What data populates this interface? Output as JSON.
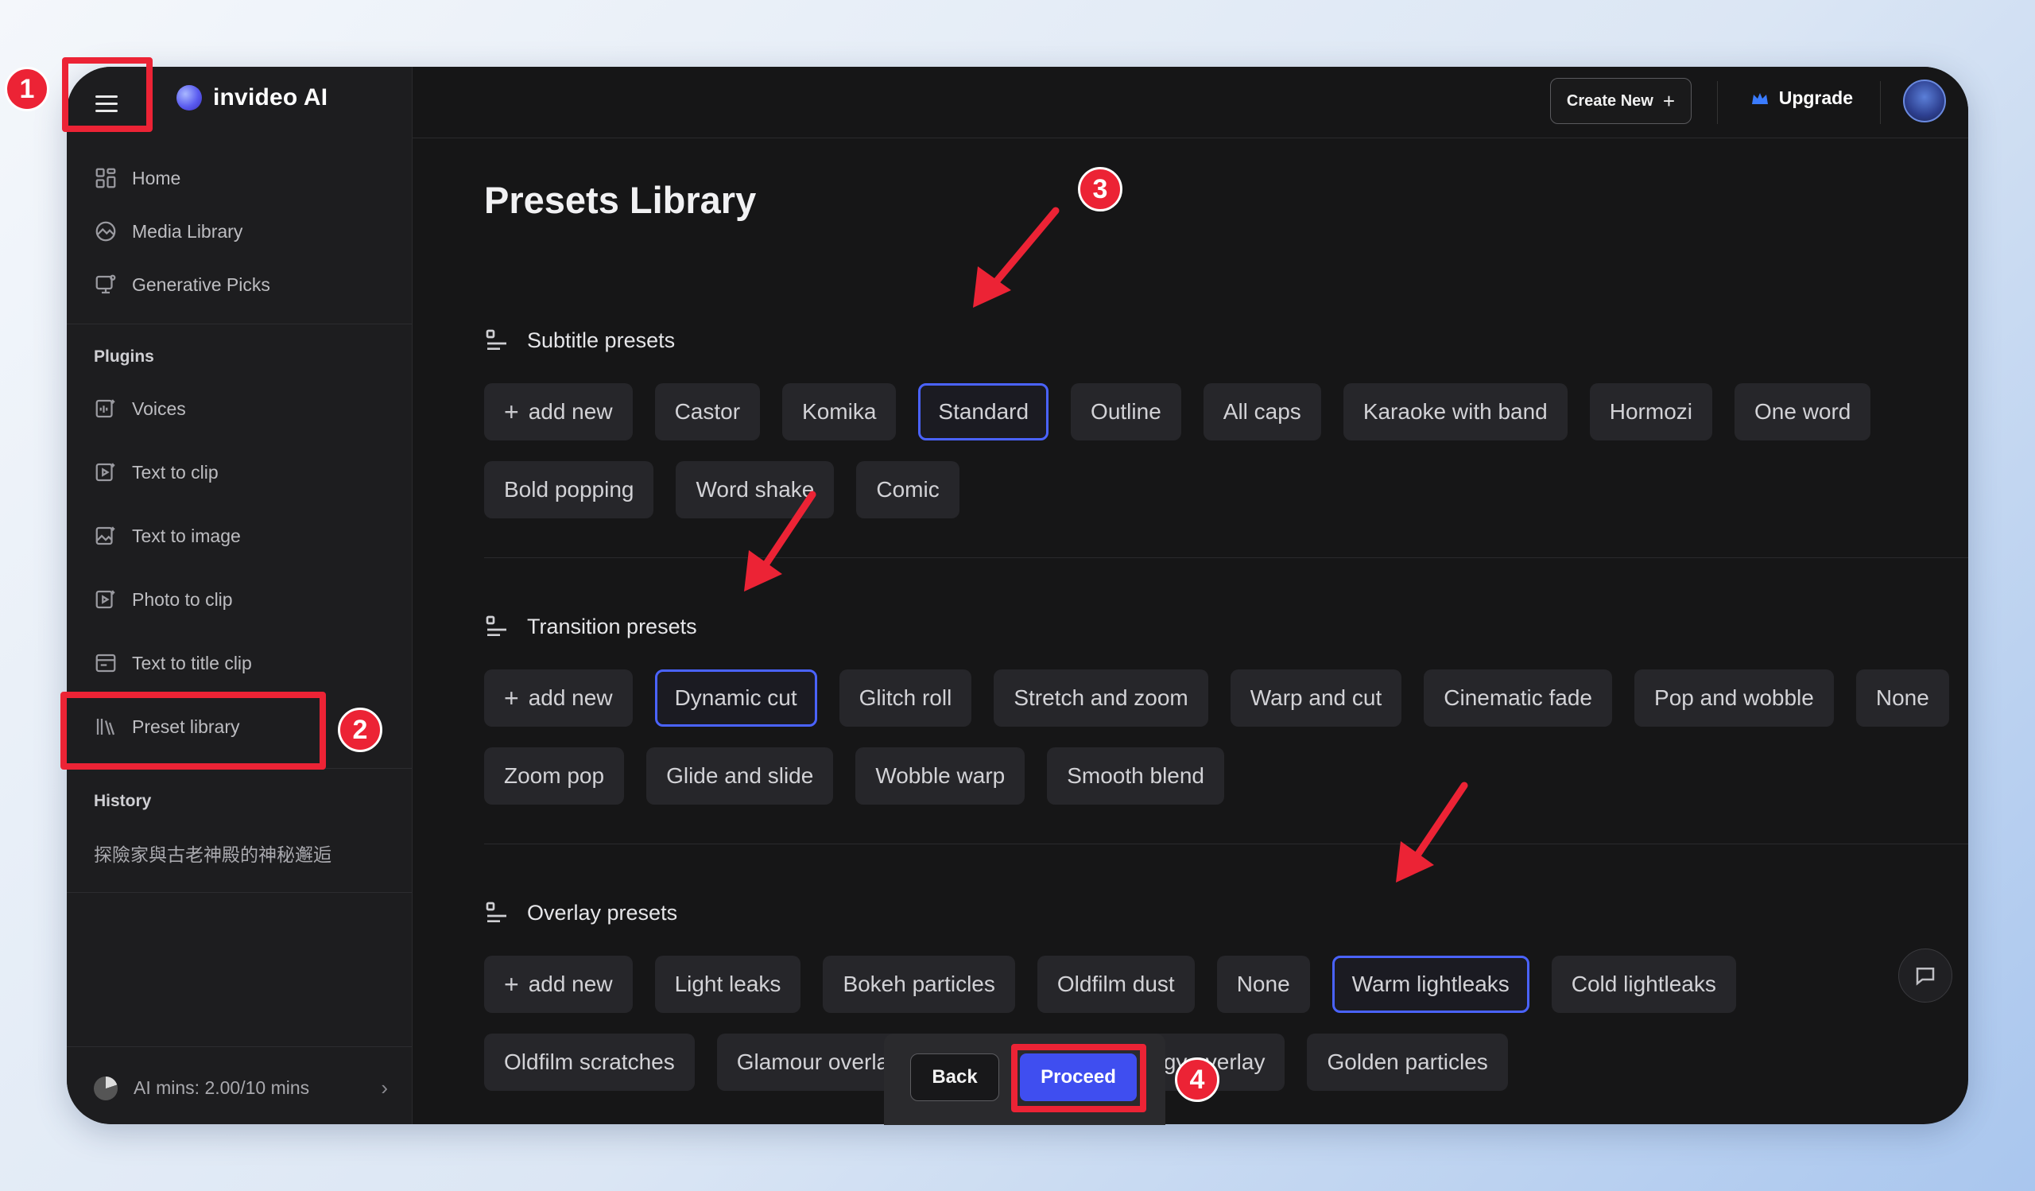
{
  "app": {
    "name": "invideo AI"
  },
  "sidebar": {
    "items": [
      {
        "label": "Home",
        "icon": "home-icon"
      },
      {
        "label": "Media Library",
        "icon": "media-library-icon"
      },
      {
        "label": "Generative Picks",
        "icon": "generative-picks-icon"
      }
    ],
    "plugins_title": "Plugins",
    "plugins": [
      {
        "label": "Voices",
        "icon": "voices-icon"
      },
      {
        "label": "Text to clip",
        "icon": "text-to-clip-icon"
      },
      {
        "label": "Text to image",
        "icon": "text-to-image-icon"
      },
      {
        "label": "Photo to clip",
        "icon": "photo-to-clip-icon"
      },
      {
        "label": "Text to title clip",
        "icon": "text-to-title-clip-icon"
      },
      {
        "label": "Preset library",
        "icon": "preset-library-icon"
      }
    ],
    "history_title": "History",
    "history": [
      "探險家與古老神殿的神秘邂逅"
    ],
    "ai_mins": "AI mins: 2.00/10 mins"
  },
  "topbar": {
    "create_new": "Create New",
    "upgrade": "Upgrade"
  },
  "page": {
    "title": "Presets Library",
    "add_new": "add new",
    "sections": [
      {
        "title": "Subtitle presets",
        "presets": [
          "Castor",
          "Komika",
          "Standard",
          "Outline",
          "All caps",
          "Karaoke with band",
          "Hormozi",
          "One word",
          "Bold popping",
          "Word shake",
          "Comic"
        ],
        "selected": "Standard"
      },
      {
        "title": "Transition presets",
        "presets": [
          "Dynamic cut",
          "Glitch roll",
          "Stretch and zoom",
          "Warp and cut",
          "Cinematic fade",
          "Pop and wobble",
          "None",
          "Zoom pop",
          "Glide and slide",
          "Wobble warp",
          "Smooth blend"
        ],
        "selected": "Dynamic cut"
      },
      {
        "title": "Overlay presets",
        "presets": [
          "Light leaks",
          "Bokeh particles",
          "Oldfilm dust",
          "None",
          "Warm lightleaks",
          "Cold lightleaks",
          "Oldfilm scratches",
          "Glamour overlay with bokhe",
          "Technology overlay",
          "Golden particles"
        ],
        "selected": "Warm lightleaks"
      }
    ]
  },
  "actions": {
    "back": "Back",
    "proceed": "Proceed"
  },
  "annotations": [
    "1",
    "2",
    "3",
    "4"
  ],
  "colors": {
    "accent": "#3f4ef0",
    "highlight": "#ec2335",
    "selected_border": "#4a63ff"
  }
}
